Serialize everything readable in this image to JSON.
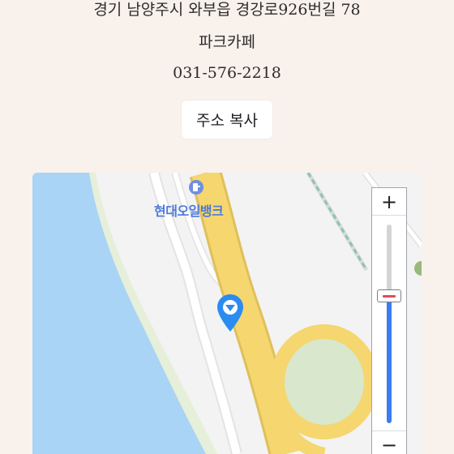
{
  "info": {
    "address": "경기 남양주시 와부읍 경강로926번길 78",
    "place_name": "파크카페",
    "phone": "031-576-2218"
  },
  "actions": {
    "copy_address_label": "주소 복사"
  },
  "map": {
    "poi_label": "현대오일뱅크",
    "zoom_in_symbol": "+",
    "zoom_out_symbol": "−",
    "zoom_level_fraction": 0.64,
    "colors": {
      "water": "#a9d4f5",
      "land": "#f3f3f3",
      "park": "#d9e7cc",
      "road": "#f5d66f",
      "road_border": "#dfc05c",
      "marker": "#2b8cf0",
      "poi": "#4e7ad7"
    },
    "icons": {
      "poi": "gas-station-icon",
      "marker": "location-pin-icon"
    }
  }
}
